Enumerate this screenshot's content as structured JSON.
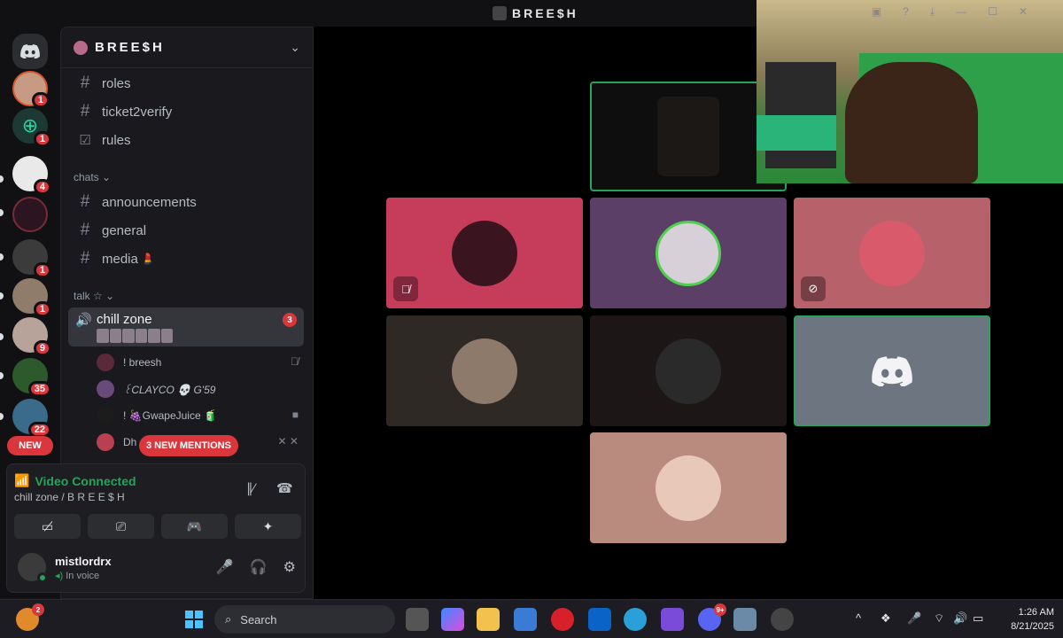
{
  "window": {
    "title": "BREE$H"
  },
  "rail": {
    "badges": [
      "1",
      "1",
      "4",
      "1",
      "1",
      "9",
      "35",
      "22"
    ],
    "new_label": "NEW"
  },
  "server": {
    "name": "BREE$H"
  },
  "channels": {
    "top": [
      {
        "name": "roles"
      },
      {
        "name": "ticket2verify"
      },
      {
        "name": "rules"
      }
    ],
    "category_chats": "chats",
    "chats": [
      {
        "name": "announcements"
      },
      {
        "name": "general"
      },
      {
        "name": "media"
      }
    ],
    "category_talk": "talk ☆",
    "voice": {
      "name": "chill zone",
      "badge": "3"
    },
    "voice_users": [
      {
        "name": "! breesh"
      },
      {
        "name": "꒰CLAYCO 💀 G'59"
      },
      {
        "name": "! 🍇GwapeJuice 🧃"
      },
      {
        "name": "Dh"
      }
    ],
    "mentions_label": "3 NEW MENTIONS"
  },
  "rtc": {
    "status": "Video Connected",
    "location": "chill zone / B R E E $ H"
  },
  "user": {
    "name": "mistlordrx",
    "status": "In voice"
  },
  "tiles": {
    "colors": [
      "#c63d5b",
      "#5b3f66",
      "#b7626b",
      "#2e2925",
      "#1d1617",
      "#6c7580",
      "#b98a7e"
    ]
  },
  "taskbar": {
    "search_placeholder": "Search",
    "discord_badge": "9+",
    "time": "1:26 AM",
    "date": "8/21/2025",
    "weather_badge": "2"
  }
}
